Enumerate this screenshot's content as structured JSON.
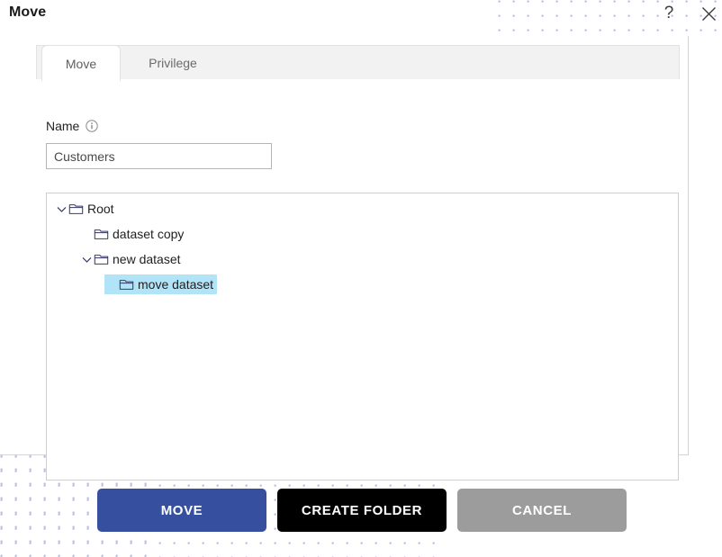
{
  "titlebar": {
    "title": "Move",
    "help_icon": "question-mark-help-icon",
    "help_glyph": "?",
    "close_icon": "close-icon"
  },
  "tabs": [
    {
      "label": "Move",
      "active": true
    },
    {
      "label": "Privilege",
      "active": false
    }
  ],
  "form": {
    "name_label": "Name",
    "info_icon": "info-circle-icon",
    "name_value": "Customers",
    "name_placeholder": "Name"
  },
  "tree": {
    "nodes": [
      {
        "label": "Root",
        "depth": 0,
        "expanded": true,
        "has_children": true,
        "selected": false,
        "icon": "folder-icon"
      },
      {
        "label": "dataset copy",
        "depth": 1,
        "expanded": false,
        "has_children": false,
        "selected": false,
        "icon": "folder-icon"
      },
      {
        "label": "new dataset",
        "depth": 1,
        "expanded": true,
        "has_children": true,
        "selected": false,
        "icon": "folder-icon"
      },
      {
        "label": "move dataset",
        "depth": 2,
        "expanded": false,
        "has_children": false,
        "selected": true,
        "icon": "folder-icon"
      }
    ]
  },
  "footer": {
    "move_label": "MOVE",
    "create_folder_label": "CREATE FOLDER",
    "cancel_label": "CANCEL"
  },
  "colors": {
    "primary": "#36509f",
    "secondary": "#000000",
    "cancel": "#9c9c9c",
    "selection": "#b2e4f7",
    "dot_pattern": "#b9c0ea",
    "tab_strip": "#f2f2f2"
  }
}
